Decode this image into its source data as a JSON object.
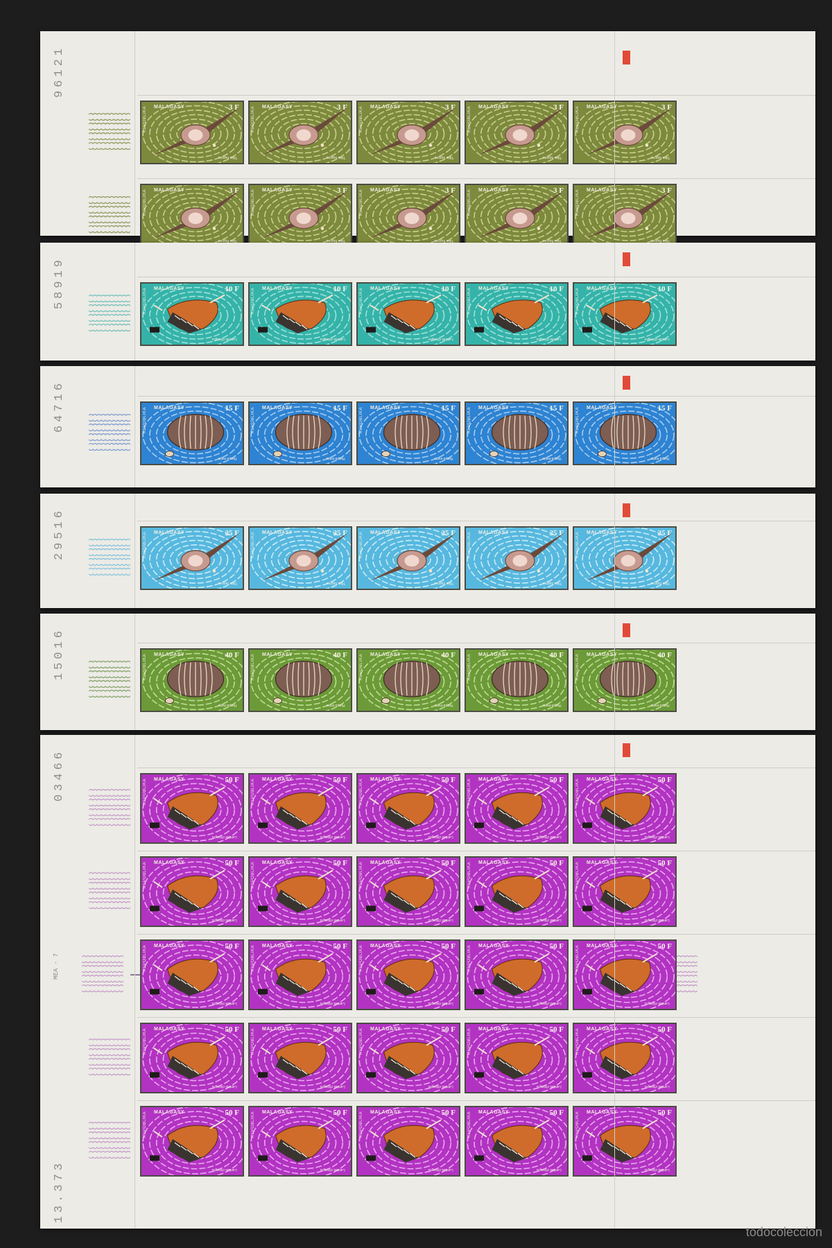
{
  "sheets": [
    {
      "serial": "96121",
      "rows": 2,
      "country": "MALAGASY",
      "side_text": "REPOBLIKA",
      "value": "3 F",
      "caption": "Tibia rugosa",
      "designer": "Bequet",
      "ground_color": "#7d8a3d",
      "wave_color": "#c9cf8b",
      "plate_color": "#9aa06a",
      "shell_icon": "spindle-shell-icon"
    },
    {
      "serial": "58919",
      "rows": 1,
      "country": "MALAGASY",
      "side_text": "REPOBLIKA",
      "value": "10 F",
      "caption": "Lambis chiragra",
      "designer": "Bequet",
      "ground_color": "#35b3a9",
      "wave_color": "#9ee2da",
      "plate_color": "#7ec3bc",
      "shell_icon": "conch-shell-icon"
    },
    {
      "serial": "64716",
      "rows": 1,
      "country": "MALAGASY",
      "side_text": "REPOBLIKA",
      "value": "15 F",
      "caption": "Harpa major",
      "designer": "Bequet",
      "ground_color": "#2e83d2",
      "wave_color": "#a5cdf2",
      "plate_color": "#8aa3d2",
      "shell_icon": "harp-shell-icon"
    },
    {
      "serial": "29516",
      "rows": 1,
      "country": "MALAGASY",
      "side_text": "REPOBLIKA",
      "value": "25 F",
      "caption": "Tibia rugosa",
      "designer": "Bequet",
      "ground_color": "#57b8df",
      "wave_color": "#c8ecf7",
      "plate_color": "#8cc6dc",
      "shell_icon": "spindle-shell-icon"
    },
    {
      "serial": "15016",
      "rows": 1,
      "country": "MALAGASY",
      "side_text": "REPOBLIKA",
      "value": "40 F",
      "caption": "Harpa major",
      "designer": "Bequet",
      "ground_color": "#6c9a38",
      "wave_color": "#bedd93",
      "plate_color": "#8fa975",
      "shell_icon": "harp-shell-icon"
    },
    {
      "serial": "03466",
      "serial_bottom": "13.373",
      "press_date": "MEA - 7",
      "rows": 5,
      "country": "MALAGASY",
      "side_text": "REPOBLIKA",
      "value": "50 F",
      "caption": "Lambis chiragra",
      "designer": "Bequet",
      "ground_color": "#b233c2",
      "wave_color": "#eaa7f1",
      "plate_color": "#c9a3cb",
      "shell_icon": "conch-shell-icon"
    }
  ],
  "bottom_mark": "todocoleccion"
}
